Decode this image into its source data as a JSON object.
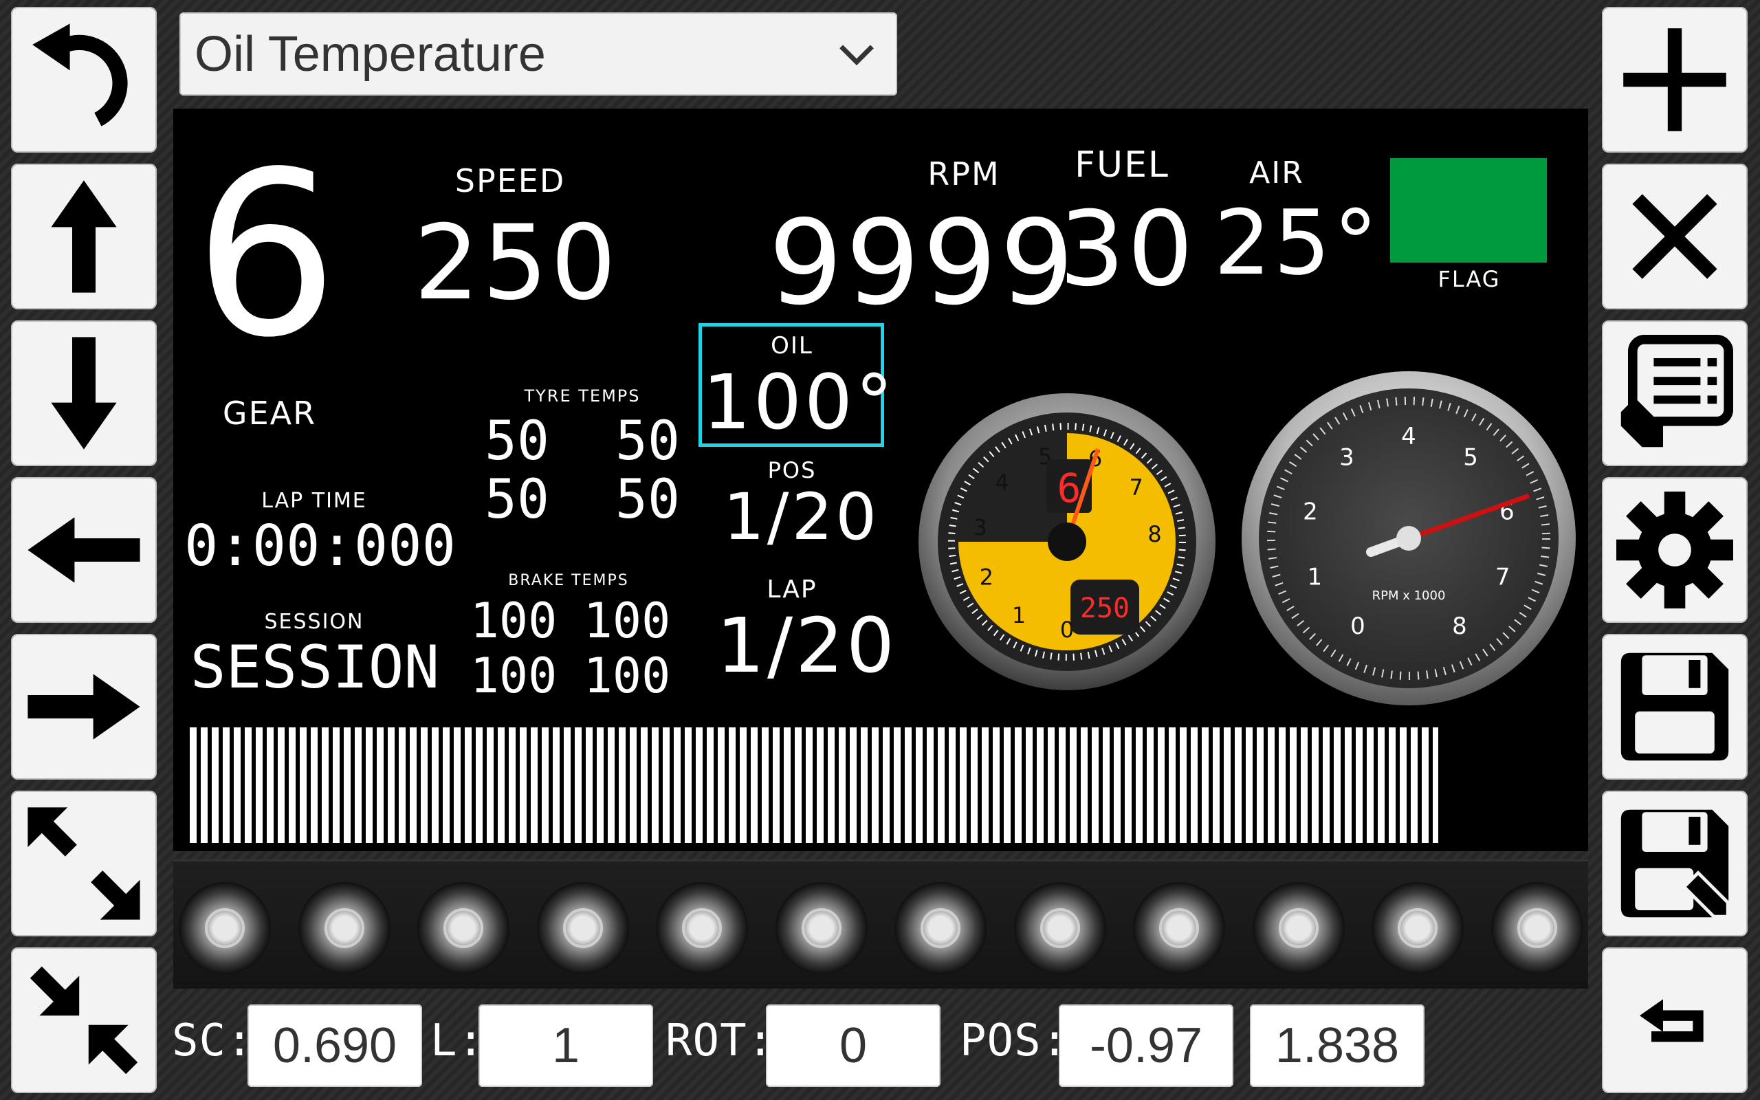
{
  "toolbar_left": [
    {
      "name": "undo-button",
      "icon": "undo-icon"
    },
    {
      "name": "move-up-button",
      "icon": "arrow-up-icon"
    },
    {
      "name": "move-down-button",
      "icon": "arrow-down-icon"
    },
    {
      "name": "move-left-button",
      "icon": "arrow-left-icon"
    },
    {
      "name": "move-right-button",
      "icon": "arrow-right-icon"
    },
    {
      "name": "expand-button",
      "icon": "expand-icon"
    },
    {
      "name": "shrink-button",
      "icon": "shrink-icon"
    }
  ],
  "toolbar_right": [
    {
      "name": "add-button",
      "icon": "plus-icon"
    },
    {
      "name": "delete-button",
      "icon": "close-icon"
    },
    {
      "name": "edit-list-button",
      "icon": "edit-list-icon"
    },
    {
      "name": "settings-button",
      "icon": "gear-icon"
    },
    {
      "name": "save-button",
      "icon": "save-icon"
    },
    {
      "name": "save-as-button",
      "icon": "save-edit-icon"
    },
    {
      "name": "back-button",
      "icon": "return-icon"
    }
  ],
  "selector": {
    "selected": "Oil Temperature"
  },
  "dash": {
    "gear": {
      "value": "6",
      "label": "GEAR"
    },
    "speed": {
      "value": "250",
      "label": "SPEED"
    },
    "rpm": {
      "value": "9999",
      "label": "RPM"
    },
    "fuel": {
      "value": "30",
      "label": "FUEL"
    },
    "air": {
      "value": "25°",
      "label": "AIR"
    },
    "flag": {
      "label": "FLAG",
      "color": "#009a3e"
    },
    "oil": {
      "value": "100°",
      "label": "OIL"
    },
    "tyre_temps": {
      "label": "TYRE TEMPS",
      "values": [
        "50",
        "50",
        "50",
        "50"
      ]
    },
    "brake_temps": {
      "label": "BRAKE TEMPS",
      "values": [
        "100",
        "100",
        "100",
        "100"
      ]
    },
    "lap_time": {
      "label": "LAP TIME",
      "value": "0:00:000"
    },
    "session": {
      "label": "SESSION",
      "value": "SESSION"
    },
    "pos": {
      "label": "POS",
      "value": "1/20"
    },
    "lap": {
      "label": "LAP",
      "value": "1/20"
    },
    "yellow_gauge": {
      "ticks": [
        "0",
        "1",
        "2",
        "3",
        "4",
        "5",
        "6",
        "7",
        "8"
      ],
      "gear_readout": "6",
      "speed_readout": "250"
    },
    "silver_gauge": {
      "ticks": [
        "0",
        "1",
        "2",
        "3",
        "4",
        "5",
        "6",
        "7",
        "8"
      ],
      "unit": "RPM x 1000"
    }
  },
  "led_count": 12,
  "bottom": {
    "sc_label": "SC:",
    "sc_value": "0.690",
    "l_label": "L:",
    "l_value": "1",
    "rot_label": "ROT:",
    "rot_value": "0",
    "pos_label": "POS:",
    "pos_x": "-0.97",
    "pos_y": "1.838"
  }
}
